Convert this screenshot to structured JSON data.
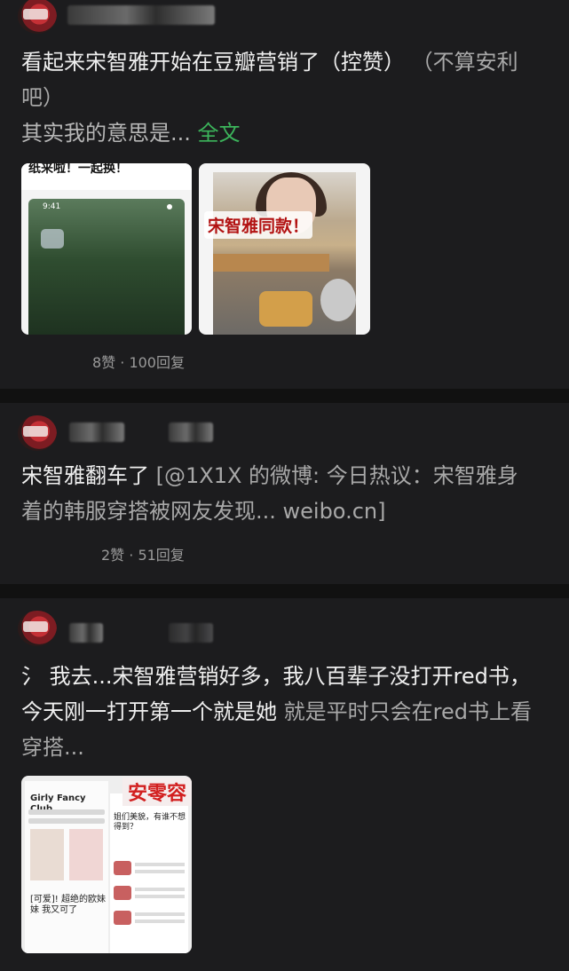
{
  "posts": [
    {
      "title": "看起来宋智雅开始在豆瓣营销了（控赞）",
      "title_extra": "（不算安利吧）",
      "excerpt": "其实我的意思是...",
      "more_link": "全文",
      "thumb1_caption": "纸来啦！一起换！",
      "thumb1_time": "9:41",
      "thumb2_caption": "宋智雅同款！",
      "meta": "8赞 · 100回复"
    },
    {
      "title": "宋智雅翻车了",
      "link_text": "[@1X1X 的微博: 今日热议：宋智雅身着的韩服穿搭被网友发现... weibo.cn]",
      "meta": "2赞 · 51回复"
    },
    {
      "prefix": "氵",
      "title": "我去...宋智雅营销好多，我八百辈子没打开red书，今天刚一打开第一个就是她",
      "excerpt": "就是平时只会在red书上看穿搭...",
      "thumb_stamp": "安零容",
      "shop_text1": "Girly Fancy Club",
      "shop_text2": "[可爱]! 超绝的欧妹妹 我又可了",
      "shop_text3": "姐们美貌，有谁不想得到？"
    }
  ],
  "colors": {
    "background": "#111111",
    "card": "#1c1c1e",
    "link_green": "#3cb45b"
  }
}
